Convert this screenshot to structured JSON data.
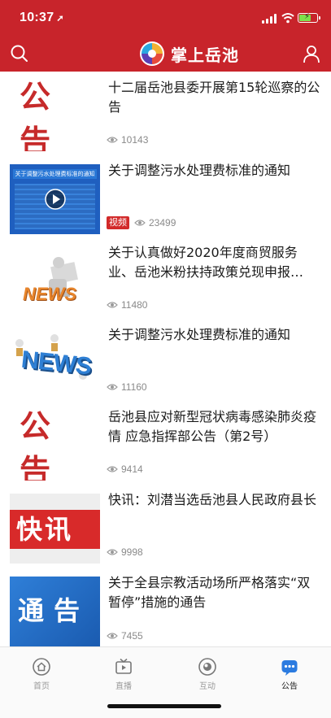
{
  "status": {
    "time": "10:37",
    "location_icon": "location-arrow-icon",
    "battery_color": "#7ee14b"
  },
  "header": {
    "app_title": "掌上岳池",
    "brand_color": "#c8242b"
  },
  "feed": [
    {
      "title": "十二届岳池县委开展第15轮巡察的公告",
      "views": "10143",
      "thumb": "公告"
    },
    {
      "title": "关于调整污水处理费标准的通知",
      "views": "23499",
      "badge": "视频",
      "thumb_caption": "关于调整污水处理费标准的通知"
    },
    {
      "title": "关于认真做好2020年度商贸服务业、岳池米粉扶持政策兑现申报…",
      "views": "11480",
      "thumb": "NEWS"
    },
    {
      "title": "关于调整污水处理费标准的通知",
      "views": "11160",
      "thumb": "NEWS"
    },
    {
      "title": "岳池县应对新型冠状病毒感染肺炎疫情 应急指挥部公告（第2号）",
      "views": "9414",
      "thumb": "公告"
    },
    {
      "title": "快讯：刘潜当选岳池县人民政府县长",
      "views": "9998",
      "thumb": "快讯"
    },
    {
      "title": "关于全县宗教活动场所严格落实“双暂停”措施的通告",
      "views": "7455",
      "thumb": "通告"
    }
  ],
  "tabs": [
    {
      "label": "首页",
      "icon": "home-icon"
    },
    {
      "label": "直播",
      "icon": "tv-icon"
    },
    {
      "label": "互动",
      "icon": "interaction-icon"
    },
    {
      "label": "公告",
      "icon": "announcement-icon",
      "active": true
    }
  ]
}
